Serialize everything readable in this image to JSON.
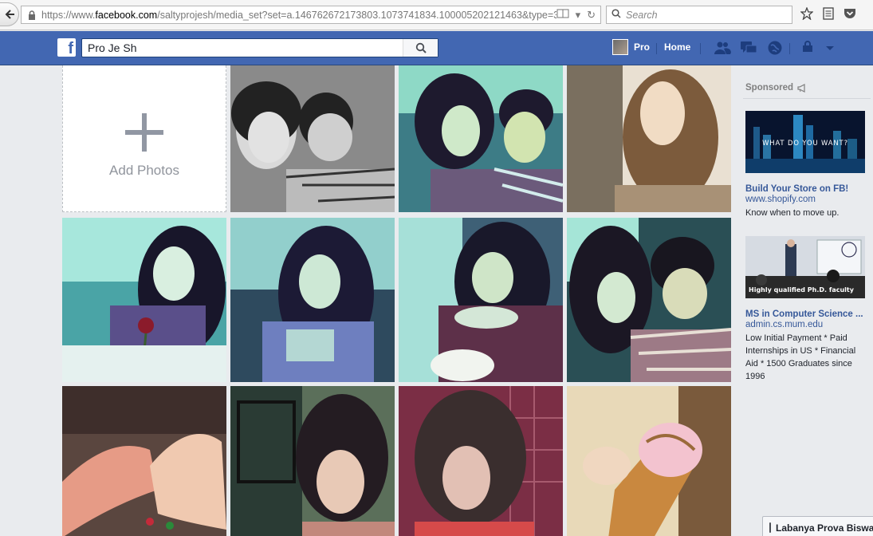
{
  "browser": {
    "url_prefix": "https://www.",
    "url_domain": "facebook.com",
    "url_rest": "/saltyprojesh/media_set?set=a.146762672173803.1073741834.100005202121463&type=3",
    "search_placeholder": "Search"
  },
  "header": {
    "logo": "f",
    "search_value": "Pro Je Sh",
    "profile_name": "Pro",
    "home_label": "Home"
  },
  "album": {
    "add_photos_label": "Add Photos"
  },
  "sidebar": {
    "sponsored_label": "Sponsored",
    "ads": [
      {
        "image_caption": "WHAT DO YOU WANT?",
        "title": "Build Your Store on FB!",
        "url": "www.shopify.com",
        "body": "Know when to move up."
      },
      {
        "image_caption": "Highly qualified Ph.D. faculty",
        "title": "MS in Computer Science ...",
        "url": "admin.cs.mum.edu",
        "body": "Low Initial Payment * Paid Internships in US * Financial Aid * 1500 Graduates since 1996"
      }
    ]
  },
  "chat": {
    "contact_name": "Labanya Prova Biswas"
  },
  "colors": {
    "fb_blue": "#4267b2",
    "link_blue": "#365899",
    "background": "#e9ebee"
  }
}
